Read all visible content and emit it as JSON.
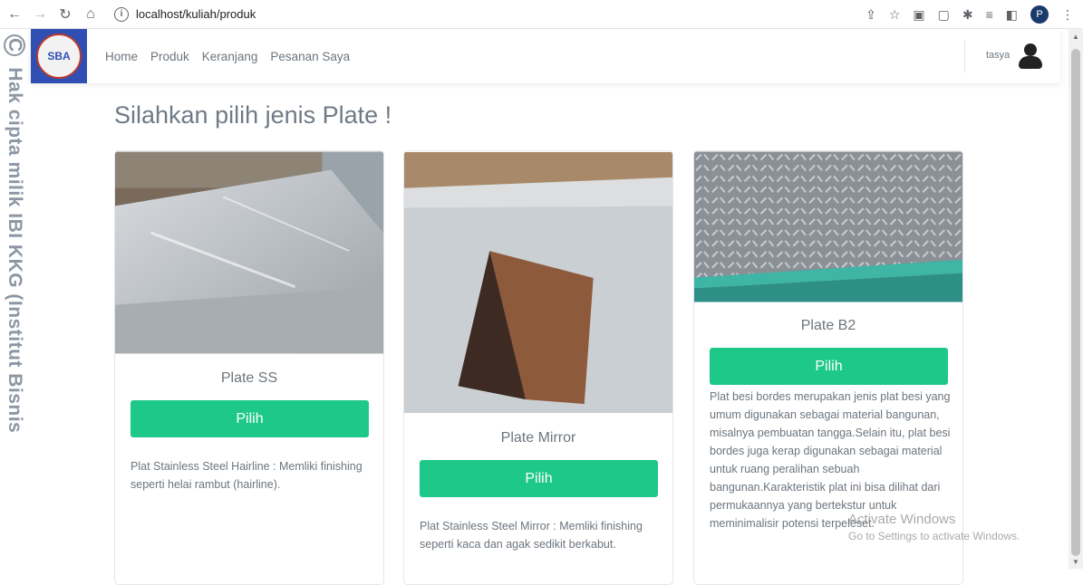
{
  "browser": {
    "url": "localhost/kuliah/produk",
    "profile_initial": "P"
  },
  "watermark": "Hak cipta milik IBI KKG (Institut Bisnis",
  "watermark_symbol": "C",
  "navbar": {
    "logo_text": "SBA",
    "links": [
      "Home",
      "Produk",
      "Keranjang",
      "Pesanan Saya"
    ],
    "user_name": "tasya"
  },
  "page": {
    "title": "Silahkan pilih jenis Plate !"
  },
  "cards": [
    {
      "title": "Plate SS",
      "button_label": "Pilih",
      "description": "Plat Stainless Steel Hairline : Memliki finishing seperti helai rambut (hairline)."
    },
    {
      "title": "Plate Mirror",
      "button_label": "Pilih",
      "description": "Plat Stainless Steel Mirror : Memliki finishing seperti kaca dan agak sedikit berkabut."
    },
    {
      "title": "Plate B2",
      "button_label": "Pilih",
      "description": "Plat besi bordes merupakan jenis plat besi yang umum digunakan sebagai material bangunan, misalnya pembuatan tangga.Selain itu, plat besi bordes juga kerap digunakan sebagai material untuk ruang peralihan sebuah bangunan.Karakteristik plat ini bisa dilihat dari permukaannya yang bertekstur untuk meminimalisir potensi terpeleset."
    }
  ],
  "os_overlay": {
    "title": "Activate Windows",
    "subtitle": "Go to Settings to activate Windows."
  },
  "colors": {
    "accent_button": "#1dc888",
    "logo_bg": "#2f4fb3"
  }
}
